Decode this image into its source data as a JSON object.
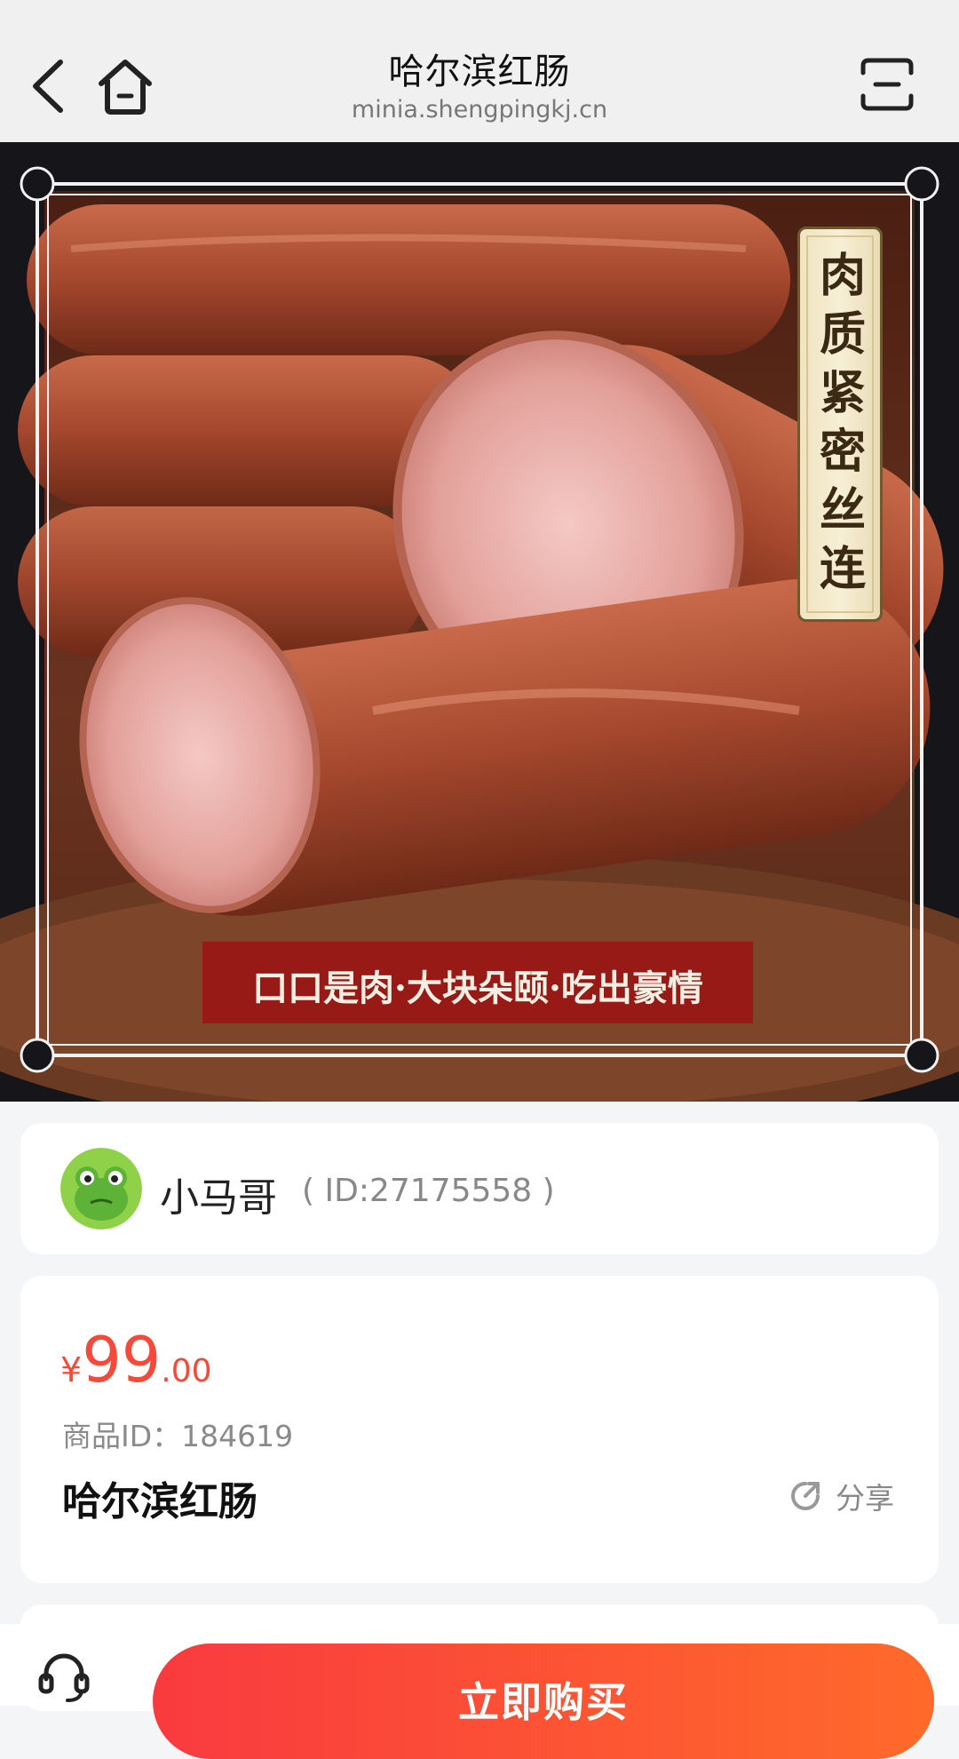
{
  "header": {
    "title": "哈尔滨红肠",
    "url": "minia.shengpingkj.cn",
    "back_icon": "chevron-left-icon",
    "home_icon": "home-icon",
    "menu_icon": "menu-icon"
  },
  "hero": {
    "vertical_banner": "肉\n质\n紧\n密\n丝\n连",
    "horizontal_banner": "口口是肉·大块朵颐·吃出豪情"
  },
  "seller": {
    "name": "小马哥",
    "id_text": "( ID:27175558 )",
    "avatar_icon": "frog-avatar"
  },
  "product": {
    "price_symbol": "¥",
    "price_int": "99",
    "price_dec": ".00",
    "product_id": "商品ID：184619",
    "name": "哈尔滨红肠",
    "share_label": "分享",
    "share_icon": "share-icon"
  },
  "bottom": {
    "service_icon": "customer-service-icon",
    "buy_label": "立即购买"
  },
  "colors": {
    "price": "#f5493a",
    "buy_gradient_start": "#f93a3f",
    "buy_gradient_end": "#ff6a2a"
  }
}
